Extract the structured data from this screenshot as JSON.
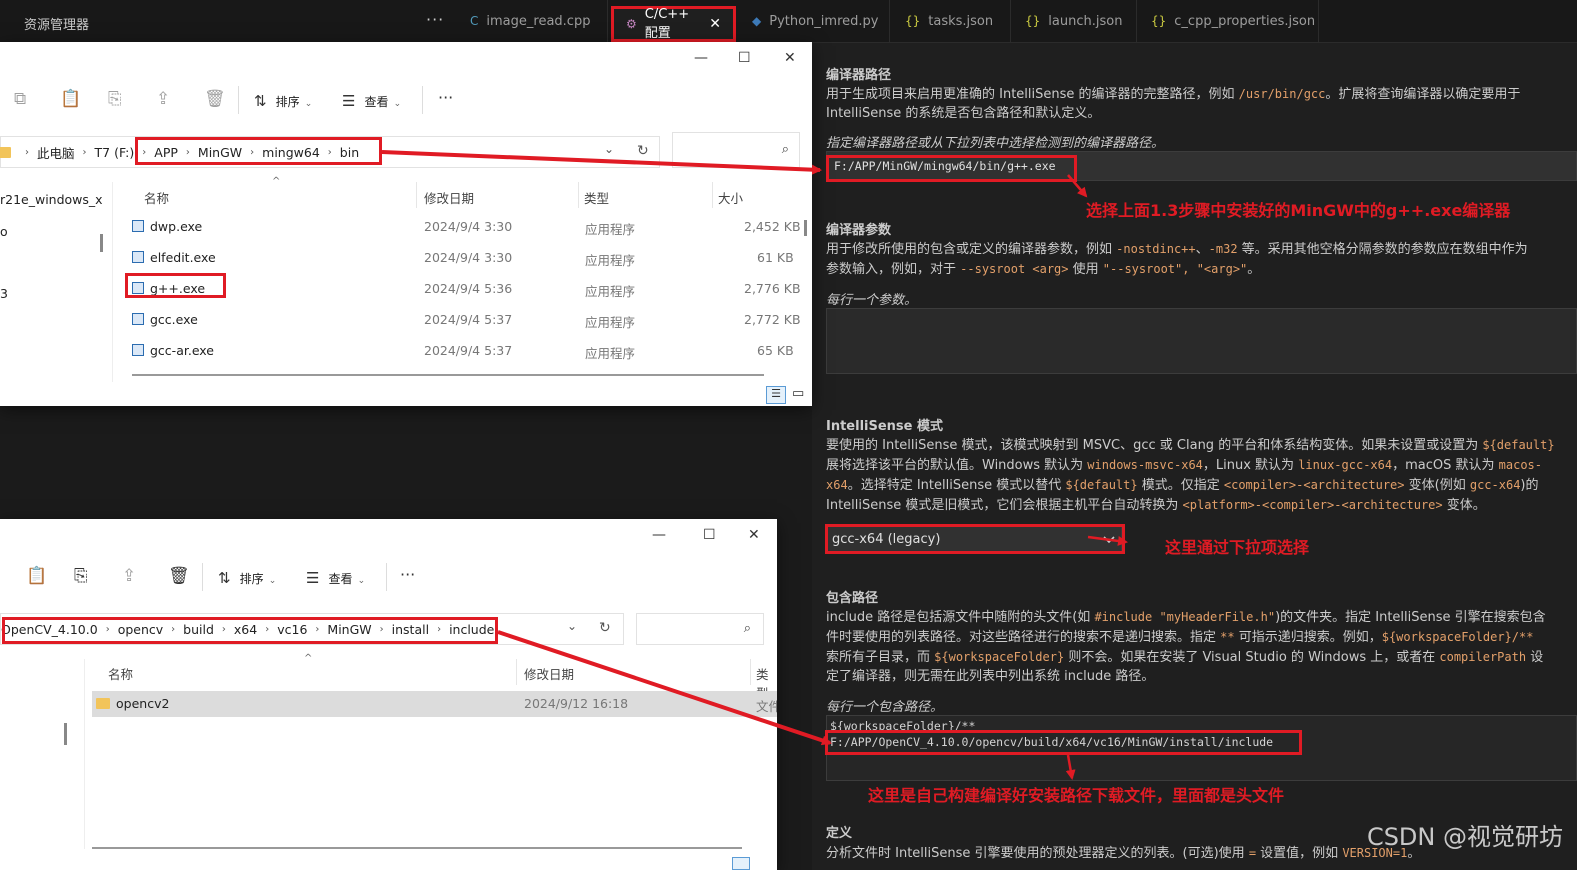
{
  "vscode": {
    "explorer_title": "资源管理器",
    "more": "···",
    "tabs": [
      {
        "icon": "C",
        "label": "image_read.cpp"
      },
      {
        "icon": "⚙",
        "label": "C/C++ 配置",
        "close": "✕"
      },
      {
        "icon": "◆",
        "label": "Python_imred.py"
      },
      {
        "icon": "{}",
        "label": "tasks.json"
      },
      {
        "icon": "{}",
        "label": "launch.json"
      },
      {
        "icon": "{}",
        "label": "c_cpp_properties.json"
      }
    ]
  },
  "settings": {
    "compiler_path": {
      "title": "编译器路径",
      "desc1_a": "用于生成项目来启用更准确的 IntelliSense 的编译器的完整路径，例如 ",
      "desc1_code": "/usr/bin/gcc",
      "desc1_b": "。扩展将查询编译器以确定要用于",
      "desc2": "IntelliSense 的系统是否包含路径和默认定义。",
      "hint": "指定编译器路径或从下拉列表中选择检测到的编译器路径。",
      "value": "F:/APP/MinGW/mingw64/bin/g++.exe"
    },
    "compiler_args": {
      "title": "编译器参数",
      "desc1_a": "用于修改所使用的包含或定义的编译器参数，例如 ",
      "desc1_code1": "-nostdinc++",
      "desc1_sep": "、",
      "desc1_code2": "-m32",
      "desc1_b": " 等。采用其他空格分隔参数的参数应在数组中作为",
      "desc2_a": "参数输入，例如，对于 ",
      "desc2_code1": "--sysroot <arg>",
      "desc2_b": " 使用 ",
      "desc2_code2": "\"--sysroot\", \"<arg>\"",
      "desc2_c": "。",
      "hint": "每行一个参数。"
    },
    "intellisense": {
      "title": "IntelliSense 模式",
      "l1_a": "要使用的 IntelliSense 模式，该模式映射到 MSVC、gcc 或 Clang 的平台和体系结构变体。如果未设置或设置为 ",
      "l1_code": "${default}",
      "l2_a": "展将选择该平台的默认值。Windows 默认为 ",
      "l2_code1": "windows-msvc-x64",
      "l2_b": "，Linux 默认为 ",
      "l2_code2": "linux-gcc-x64",
      "l2_c": "，macOS 默认为 ",
      "l2_code3": "macos-",
      "l3_code1": "x64",
      "l3_a": "。选择特定 IntelliSense 模式以替代 ",
      "l3_code2": "${default}",
      "l3_b": " 模式。仅指定 ",
      "l3_code3": "<compiler>-<architecture>",
      "l3_c": " 变体(例如 ",
      "l3_code4": "gcc-x64",
      "l3_d": ")的",
      "l4_a": "IntelliSense 模式是旧模式，它们会根据主机平台自动转换为 ",
      "l4_code": "<platform>-<compiler>-<architecture>",
      "l4_b": " 变体。",
      "value": "gcc-x64 (legacy)"
    },
    "include_path": {
      "title": "包含路径",
      "l1_a": "include 路径是包括源文件中随附的头文件(如 ",
      "l1_code": "#include \"myHeaderFile.h\"",
      "l1_b": ")的文件夹。指定 IntelliSense 引擎在搜索包含",
      "l2_a": "件时要使用的列表路径。对这些路径进行的搜索不是递归搜索。指定 ",
      "l2_code1": "**",
      "l2_b": " 可指示递归搜索。例如，",
      "l2_code2": "${workspaceFolder}/**",
      "l3_a": "索所有子目录，而 ",
      "l3_code1": "${workspaceFolder}",
      "l3_b": " 则不会。如果在安装了 Visual Studio 的 Windows 上，或者在 ",
      "l3_code2": "compilerPath",
      "l3_c": " 设",
      "l4": "定了编译器，则无需在此列表中列出系统 include 路径。",
      "hint": "每行一个包含路径。",
      "line1": "${workspaceFolder}/**",
      "line2": "F:/APP/OpenCV_4.10.0/opencv/build/x64/vc16/MinGW/install/include"
    },
    "defines": {
      "title": "定义",
      "l1_a": "分析文件时 IntelliSense 引擎要使用的预处理器定义的列表。(可选)使用 ",
      "l1_code1": "=",
      "l1_b": " 设置值，例如 ",
      "l1_code2": "VERSION=1",
      "l1_c": "。"
    }
  },
  "annotations": {
    "compiler": "选择上面1.3步骤中安装好的MinGW中的g++.exe编译器",
    "dropdown": "这里通过下拉项选择",
    "include": "这里是自己构建编译好安装路径下载文件，里面都是头文件"
  },
  "explorer1": {
    "controls": {
      "min": "—",
      "max": "☐",
      "close": "✕"
    },
    "toolbar": {
      "sort": "排序",
      "view": "查看",
      "more": "···"
    },
    "breadcrumb": [
      "此电脑",
      "T7 (F:)",
      "APP",
      "MinGW",
      "mingw64",
      "bin"
    ],
    "sidebar": [
      "r21e_windows_x",
      "o",
      "3"
    ],
    "columns": {
      "name": "名称",
      "date": "修改日期",
      "type": "类型",
      "size": "大小"
    },
    "rows": [
      {
        "name": "dwp.exe",
        "date": "2024/9/4 3:30",
        "type": "应用程序",
        "size": "2,452 KB"
      },
      {
        "name": "elfedit.exe",
        "date": "2024/9/4 3:30",
        "type": "应用程序",
        "size": "61 KB"
      },
      {
        "name": "g++.exe",
        "date": "2024/9/4 5:36",
        "type": "应用程序",
        "size": "2,776 KB"
      },
      {
        "name": "gcc.exe",
        "date": "2024/9/4 5:37",
        "type": "应用程序",
        "size": "2,772 KB"
      },
      {
        "name": "gcc-ar.exe",
        "date": "2024/9/4 5:37",
        "type": "应用程序",
        "size": "65 KB"
      }
    ]
  },
  "explorer2": {
    "controls": {
      "min": "—",
      "max": "☐",
      "close": "✕"
    },
    "toolbar": {
      "sort": "排序",
      "view": "查看",
      "more": "···"
    },
    "breadcrumb": [
      "OpenCV_4.10.0",
      "opencv",
      "build",
      "x64",
      "vc16",
      "MinGW",
      "install",
      "include"
    ],
    "columns": {
      "name": "名称",
      "date": "修改日期",
      "type": "类型"
    },
    "type_partial": "文件",
    "rows": [
      {
        "name": "opencv2",
        "date": "2024/9/12 16:18"
      }
    ]
  },
  "watermark": "CSDN @视觉研坊",
  "colors": {
    "annotation": "#e01b24",
    "code": "#e3a06a"
  }
}
